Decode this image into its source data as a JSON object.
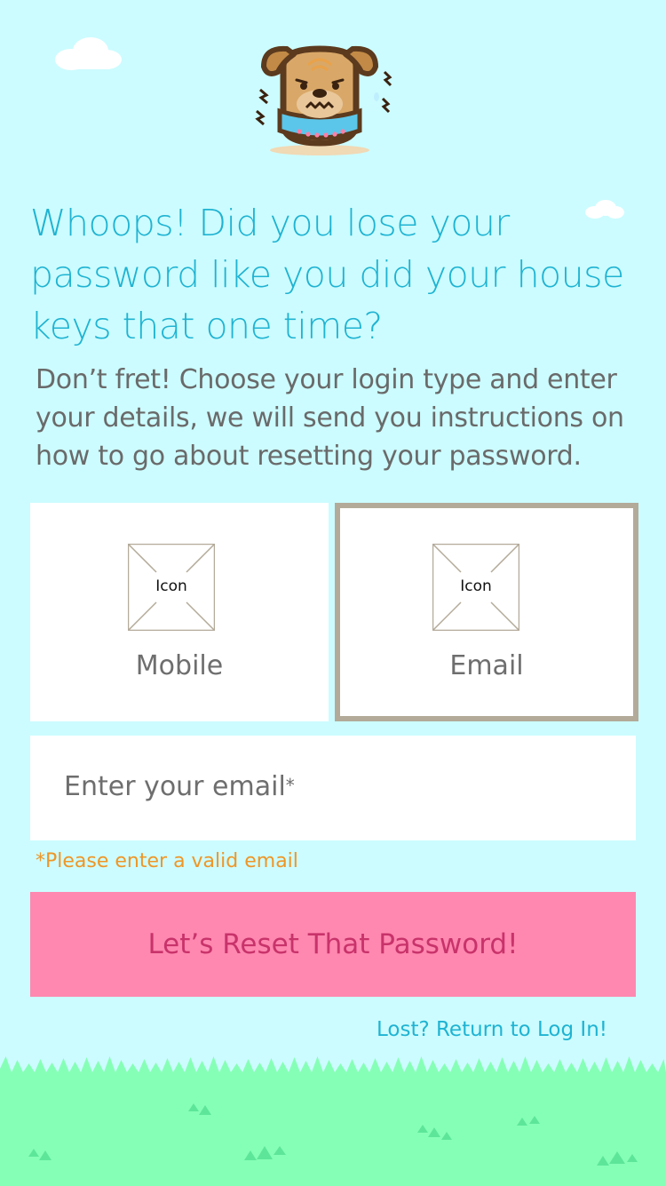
{
  "header": {
    "headline": "Whoops! Did you lose your password like you did your house keys that one time?",
    "subtext": "Don’t fret! Choose your login type and enter your details, we will send you instructions on how to go about resetting your password."
  },
  "login_types": [
    {
      "label": "Mobile",
      "icon_placeholder": "Icon",
      "icon": "image-placeholder-icon",
      "selected": false
    },
    {
      "label": "Email",
      "icon_placeholder": "Icon",
      "icon": "image-placeholder-icon",
      "selected": true
    }
  ],
  "email_field": {
    "placeholder": "Enter your email",
    "required_mark": "*"
  },
  "validation_error": "*Please enter a valid email",
  "submit_label": "Let’s Reset That Password!",
  "back_link": "Lost? Return to Log In!",
  "colors": {
    "background": "#ccfcff",
    "headline": "#1fb3d2",
    "cta_background": "#ff88b0",
    "cta_text": "#c8336a",
    "error": "#ee9627",
    "grass": "#86ffb6",
    "selected_border": "#b3aa99"
  }
}
